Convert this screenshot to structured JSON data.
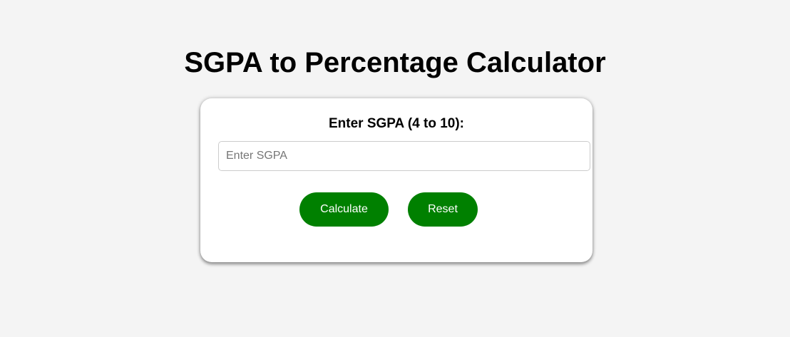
{
  "page": {
    "title": "SGPA to Percentage Calculator"
  },
  "form": {
    "label": "Enter SGPA (4 to 10):",
    "input": {
      "value": "",
      "placeholder": "Enter SGPA"
    },
    "calculate_label": "Calculate",
    "reset_label": "Reset"
  },
  "colors": {
    "background": "#f4f4f4",
    "card": "#ffffff",
    "button": "#008000",
    "button_text": "#ffffff"
  }
}
